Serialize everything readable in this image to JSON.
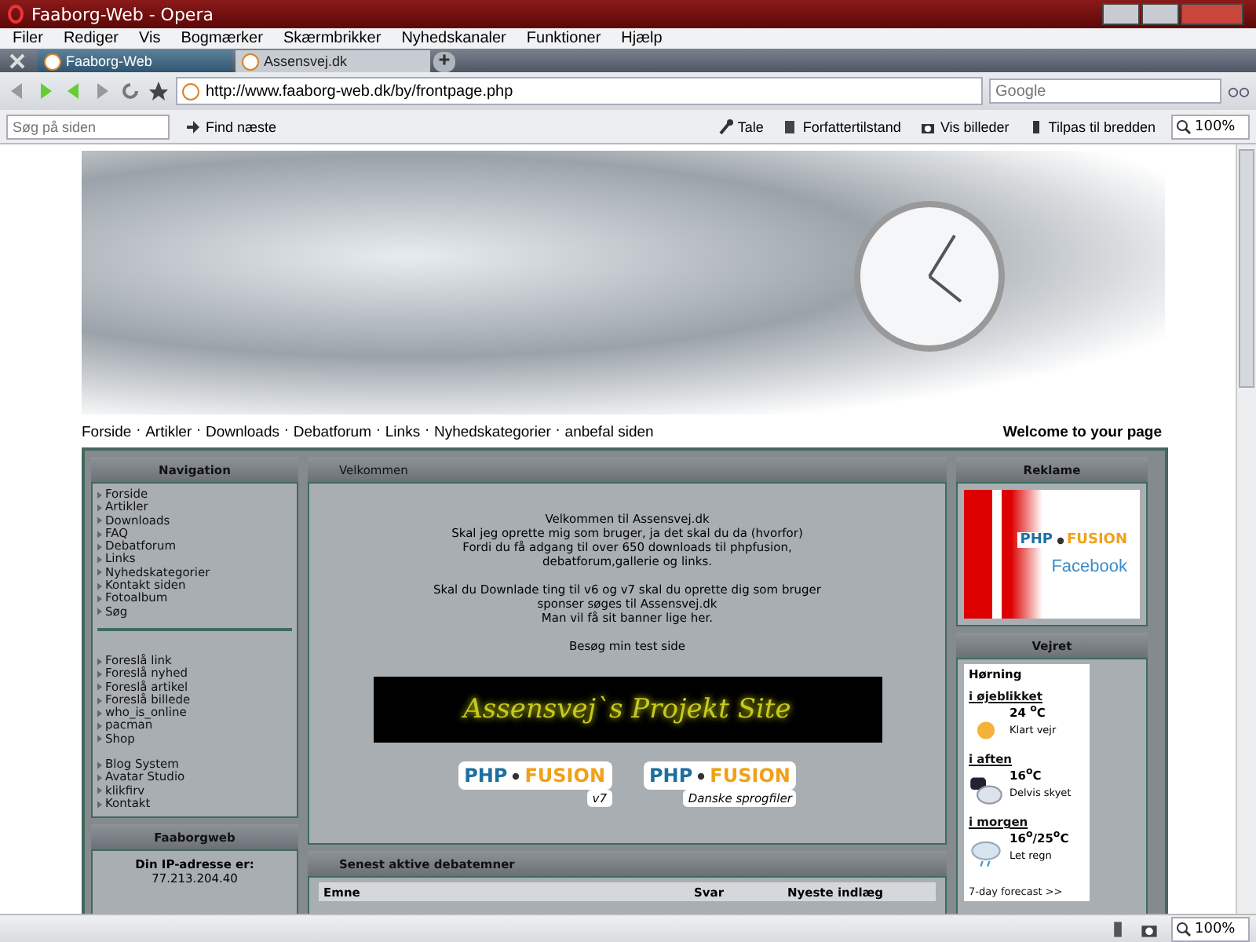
{
  "window": {
    "title": "Faaborg-Web - Opera"
  },
  "menu": [
    "Filer",
    "Rediger",
    "Vis",
    "Bogmærker",
    "Skærmbrikker",
    "Nyhedskanaler",
    "Funktioner",
    "Hjælp"
  ],
  "tabs": [
    {
      "label": "Faaborg-Web",
      "selected": true
    },
    {
      "label": "Assensvej.dk",
      "selected": false
    }
  ],
  "address": {
    "url": "http://www.faaborg-web.dk/by/frontpage.php",
    "search_placeholder": "Google"
  },
  "find_bar": {
    "placeholder": "Søg på siden",
    "find_next": "Find næste",
    "tools": [
      {
        "label": "Tale",
        "kind": "mic"
      },
      {
        "label": "Forfattertilstand",
        "kind": "doc"
      },
      {
        "label": "Vis billeder",
        "kind": "camera"
      },
      {
        "label": "Tilpas til bredden",
        "kind": "fit"
      }
    ],
    "zoom": "100%"
  },
  "page": {
    "top_links": [
      "Forside",
      "Artikler",
      "Downloads",
      "Debatforum",
      "Links",
      "Nyhedskategorier",
      "anbefal siden"
    ],
    "separator": "·",
    "welcome": "Welcome to your page",
    "navigation": {
      "title": "Navigation",
      "items": [
        "Forside",
        "Artikler",
        "Downloads",
        "FAQ",
        "Debatforum",
        "Links",
        "Nyhedskategorier",
        "Kontakt siden",
        "Fotoalbum",
        "Søg"
      ],
      "items_2": [
        "Foreslå link",
        "Foreslå nyhed",
        "Foreslå artikel",
        "Foreslå billede",
        "who_is_online",
        "pacman",
        "Shop"
      ],
      "items_3": [
        "Blog System",
        "Avatar Studio",
        "klikfirv",
        "Kontakt"
      ]
    },
    "faaborgweb": {
      "title": "Faaborgweb",
      "ip_label": "Din IP-adresse er:",
      "ip": "77.213.204.40"
    },
    "velkommen": {
      "title": "Velkommen",
      "paragraphs": [
        [
          "Velkommen til Assensvej.dk",
          "Skal jeg oprette mig som bruger, ja det skal du da (hvorfor)",
          "Fordi du få adgang til over 650 downloads til phpfusion,",
          "debatforum,gallerie og links."
        ],
        [
          "Skal du Downlade ting til v6 og v7 skal du oprette dig som bruger",
          "sponser søges til Assensvej.dk",
          "Man vil få sit banner lige her."
        ],
        [
          "Besøg min test side"
        ]
      ],
      "banner": "Assensvej`s Projekt Site",
      "logos": [
        {
          "left": "PHP",
          "right": "FUSION",
          "caption": "v7"
        },
        {
          "left": "PHP",
          "right": "FUSION",
          "caption": "Danske sprogfiler"
        }
      ]
    },
    "forum": {
      "title": "Senest aktive debatemner",
      "columns": [
        "Emne",
        "Svar",
        "Nyeste indlæg"
      ]
    },
    "reklame": {
      "title": "Reklame",
      "logo_left": "PHP",
      "logo_right": "FUSION",
      "ad_text": "Facebook"
    },
    "weather": {
      "title": "Vejret",
      "place": "Hørning",
      "periods": [
        {
          "label": "i øjeblikket",
          "temp": "24 $^{o}$C",
          "desc": "Klart vejr",
          "kind": "sun"
        },
        {
          "label": "i aften",
          "temp": "16$^{o}$C",
          "desc": "Delvis skyet",
          "kind": "moon"
        },
        {
          "label": "i morgen",
          "temp": "16$^{o}$/25$^{o}$C",
          "desc": "Let regn",
          "kind": "rain"
        }
      ],
      "forecast": "7-day forecast >>"
    }
  },
  "status_bar": {
    "zoom": "100%"
  }
}
